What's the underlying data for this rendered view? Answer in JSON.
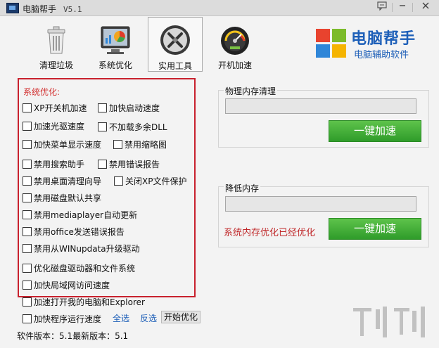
{
  "window": {
    "title": "电脑帮手",
    "version": "V5.1",
    "controls": [
      "chat-icon",
      "minimize-icon",
      "close-icon"
    ]
  },
  "toolbar": {
    "tools": [
      {
        "label": "清理垃圾",
        "icon": "trash-icon",
        "active": false
      },
      {
        "label": "系统优化",
        "icon": "monitor-chart-icon",
        "active": false
      },
      {
        "label": "实用工具",
        "icon": "tools-icon",
        "active": true
      },
      {
        "label": "开机加速",
        "icon": "speedometer-icon",
        "active": false
      }
    ]
  },
  "brand": {
    "name": "电脑帮手",
    "subtitle": "电脑辅助软件",
    "logo_colors": [
      "#e8432e",
      "#7cbb2a",
      "#2f86d8",
      "#f5b400"
    ]
  },
  "options": {
    "title": "系统优化:",
    "items": [
      {
        "label": "XP开关机加速",
        "checked": false
      },
      {
        "label": "加快启动速度",
        "checked": false
      },
      {
        "label": "加速光驱速度",
        "checked": false
      },
      {
        "label": "不加载多余DLL",
        "checked": false
      },
      {
        "label": "加快菜单显示速度",
        "checked": false
      },
      {
        "label": "禁用缩略图",
        "checked": false
      },
      {
        "label": "禁用搜索助手",
        "checked": false
      },
      {
        "label": "禁用错误报告",
        "checked": false
      },
      {
        "label": "禁用桌面清理向导",
        "checked": false
      },
      {
        "label": "关闭XP文件保护",
        "checked": false
      },
      {
        "label": "禁用磁盘默认共享",
        "checked": false
      },
      {
        "label": "禁用mediaplayer自动更新",
        "checked": false
      },
      {
        "label": "禁用office发送错误报告",
        "checked": false
      },
      {
        "label": "禁用从WINupdata升级驱动",
        "checked": false
      },
      {
        "label": "优化磁盘驱动器和文件系统",
        "checked": false
      },
      {
        "label": "加快局域网访问速度",
        "checked": false
      },
      {
        "label": "加速打开我的电脑和Explorer",
        "checked": false
      },
      {
        "label": "加快程序运行速度",
        "checked": false
      }
    ],
    "select_all": "全选",
    "invert": "反选",
    "start": "开始优化",
    "version_text": "软件版本：5.1最新版本：5.1"
  },
  "memory": {
    "physical": {
      "title": "物理内存清理",
      "button": "一键加速"
    },
    "reduce": {
      "title": "降低内存",
      "button": "一键加速",
      "message": "系统内存优化已经优化"
    }
  }
}
